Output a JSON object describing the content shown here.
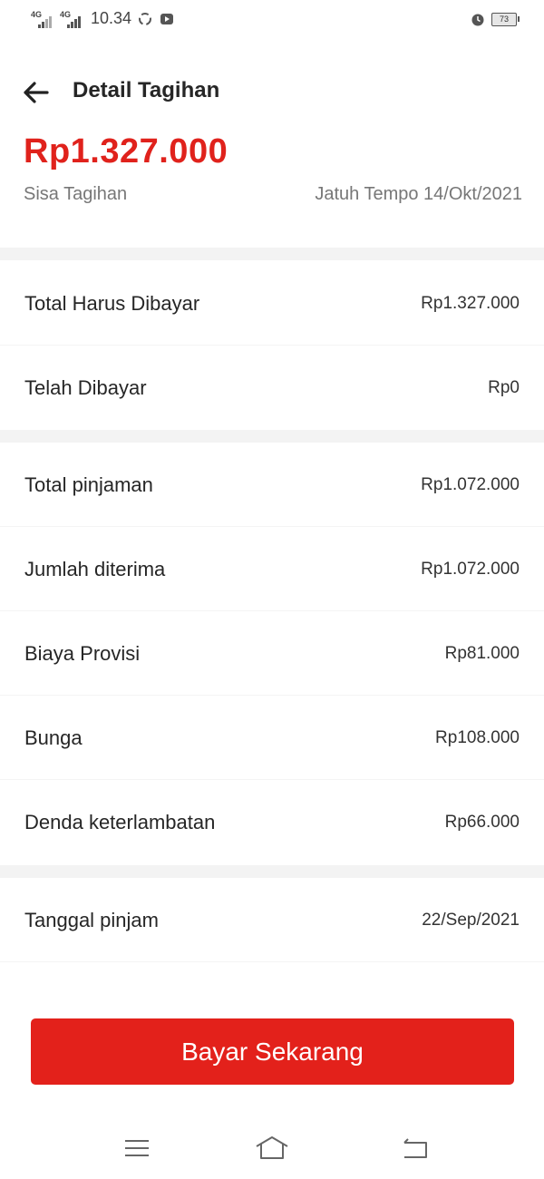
{
  "status_bar": {
    "signal1_label": "4G",
    "signal2_label": "4G",
    "time": "10.34",
    "battery": "73",
    "icons": [
      "signal-icon",
      "signal-icon",
      "sync-icon",
      "youtube-icon",
      "alarm-icon",
      "battery-icon"
    ]
  },
  "header": {
    "title": "Detail Tagihan",
    "back_icon": "arrow-left-icon"
  },
  "summary": {
    "amount": "Rp1.327.000",
    "label": "Sisa Tagihan",
    "due": "Jatuh Tempo 14/Okt/2021"
  },
  "section1": [
    {
      "label": "Total Harus Dibayar",
      "value": "Rp1.327.000"
    },
    {
      "label": "Telah Dibayar",
      "value": "Rp0"
    }
  ],
  "section2": [
    {
      "label": "Total pinjaman",
      "value": "Rp1.072.000"
    },
    {
      "label": "Jumlah diterima",
      "value": "Rp1.072.000"
    },
    {
      "label": "Biaya Provisi",
      "value": "Rp81.000"
    },
    {
      "label": "Bunga",
      "value": "Rp108.000"
    },
    {
      "label": "Denda keterlambatan",
      "value": "Rp66.000"
    }
  ],
  "section3": [
    {
      "label": "Tanggal pinjam",
      "value": "22/Sep/2021"
    }
  ],
  "pay_button": "Bayar Sekarang",
  "colors": {
    "accent": "#e3211b",
    "amount": "#e0221c",
    "divider": "#f3f3f3"
  },
  "nav": [
    "menu-icon",
    "home-icon",
    "back-icon"
  ]
}
